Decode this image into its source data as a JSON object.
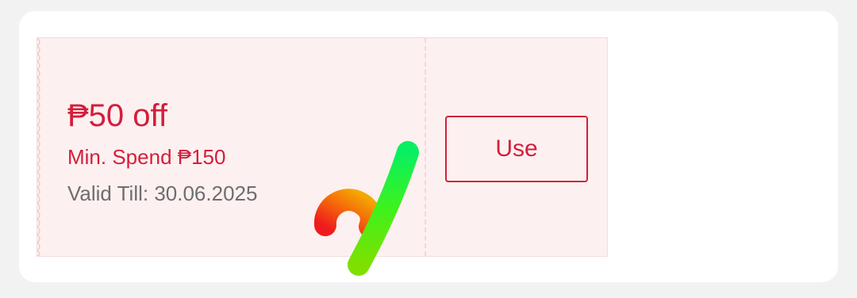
{
  "voucher": {
    "discount": "₱50 off",
    "min_spend": "Min. Spend ₱150",
    "valid_till": "Valid Till: 30.06.2025",
    "use_label": "Use"
  },
  "colors": {
    "accent": "#d21f3c",
    "voucher_bg": "#fdf0f0",
    "muted_text": "#6e6e6e"
  },
  "icons": {
    "overlay_mark": "colorful-brush-mark-icon"
  }
}
